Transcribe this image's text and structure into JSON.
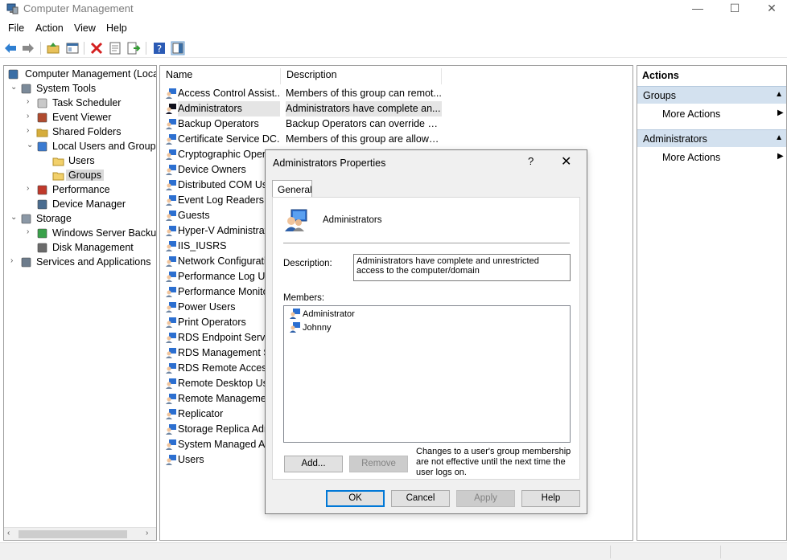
{
  "window": {
    "title": "Computer Management",
    "min_glyph": "—",
    "max_glyph": "☐",
    "close_glyph": "✕"
  },
  "menu": [
    "File",
    "Action",
    "View",
    "Help"
  ],
  "toolbar": [
    "back-arrow-icon",
    "forward-arrow-icon",
    "up-folder-icon",
    "show-hide-tree-icon",
    "delete-icon",
    "properties-icon",
    "export-list-icon",
    "help-icon",
    "show-hide-action-pane-icon"
  ],
  "tree": {
    "items": [
      {
        "label": "Computer Management (Local",
        "icon": "computer-icon",
        "arrow": "",
        "level": 0
      },
      {
        "label": "System Tools",
        "icon": "tools-icon",
        "arrow": "⌄",
        "level": 1
      },
      {
        "label": "Task Scheduler",
        "icon": "clock-icon",
        "arrow": "›",
        "level": 2
      },
      {
        "label": "Event Viewer",
        "icon": "event-viewer-icon",
        "arrow": "›",
        "level": 2
      },
      {
        "label": "Shared Folders",
        "icon": "shared-folder-icon",
        "arrow": "›",
        "level": 2
      },
      {
        "label": "Local Users and Groups",
        "icon": "users-groups-icon",
        "arrow": "⌄",
        "level": 2
      },
      {
        "label": "Users",
        "icon": "folder-icon",
        "arrow": "",
        "level": 3
      },
      {
        "label": "Groups",
        "icon": "folder-icon",
        "arrow": "",
        "level": 3,
        "selected": true
      },
      {
        "label": "Performance",
        "icon": "performance-icon",
        "arrow": "›",
        "level": 2
      },
      {
        "label": "Device Manager",
        "icon": "device-manager-icon",
        "arrow": "",
        "level": 2
      },
      {
        "label": "Storage",
        "icon": "storage-icon",
        "arrow": "⌄",
        "level": 1
      },
      {
        "label": "Windows Server Backup",
        "icon": "backup-icon",
        "arrow": "›",
        "level": 2
      },
      {
        "label": "Disk Management",
        "icon": "disk-icon",
        "arrow": "",
        "level": 2
      },
      {
        "label": "Services and Applications",
        "icon": "services-icon",
        "arrow": "›",
        "level": 1
      }
    ],
    "scroll_left": "‹",
    "scroll_right": "›"
  },
  "list": {
    "col_name": "Name",
    "col_desc": "Description",
    "rows": [
      {
        "name": "Access Control Assist...",
        "desc": "Members of this group can remot..."
      },
      {
        "name": "Administrators",
        "desc": "Administrators have complete an...",
        "selected": true
      },
      {
        "name": "Backup Operators",
        "desc": "Backup Operators can override se..."
      },
      {
        "name": "Certificate Service DC...",
        "desc": "Members of this group are allowe..."
      },
      {
        "name": "Cryptographic Opera",
        "desc": ""
      },
      {
        "name": "Device Owners",
        "desc": ""
      },
      {
        "name": "Distributed COM Use",
        "desc": ""
      },
      {
        "name": "Event Log Readers",
        "desc": ""
      },
      {
        "name": "Guests",
        "desc": ""
      },
      {
        "name": "Hyper-V Administrat",
        "desc": ""
      },
      {
        "name": "IIS_IUSRS",
        "desc": ""
      },
      {
        "name": "Network Configurati",
        "desc": ""
      },
      {
        "name": "Performance Log Us",
        "desc": ""
      },
      {
        "name": "Performance Monito",
        "desc": ""
      },
      {
        "name": "Power Users",
        "desc": ""
      },
      {
        "name": "Print Operators",
        "desc": ""
      },
      {
        "name": "RDS Endpoint Server",
        "desc": ""
      },
      {
        "name": "RDS Management Se",
        "desc": ""
      },
      {
        "name": "RDS Remote Access",
        "desc": ""
      },
      {
        "name": "Remote Desktop Use",
        "desc": ""
      },
      {
        "name": "Remote Managemen",
        "desc": ""
      },
      {
        "name": "Replicator",
        "desc": ""
      },
      {
        "name": "Storage Replica Adm",
        "desc": ""
      },
      {
        "name": "System Managed Ac",
        "desc": ""
      },
      {
        "name": "Users",
        "desc": ""
      }
    ]
  },
  "actions": {
    "header": "Actions",
    "sections": [
      {
        "title": "Groups",
        "item": "More Actions"
      },
      {
        "title": "Administrators",
        "item": "More Actions"
      }
    ],
    "collapse_glyph": "▲",
    "more_glyph": "▶"
  },
  "dialog": {
    "title": "Administrators Properties",
    "help_glyph": "?",
    "close_glyph": "✕",
    "tab": "General",
    "group_name": "Administrators",
    "description_label": "Description:",
    "description_value": "Administrators have complete and unrestricted access to the computer/domain",
    "members_label": "Members:",
    "members": [
      "Administrator",
      "Johnny"
    ],
    "add_btn": "Add...",
    "remove_btn": "Remove",
    "note": "Changes to a user's group membership are not effective until the next time the user logs on.",
    "ok_btn": "OK",
    "cancel_btn": "Cancel",
    "apply_btn": "Apply",
    "help_btn": "Help"
  },
  "colors": {
    "accent": "#0078d7",
    "section_bg": "#d3e1ef",
    "selection": "#e5e5e5"
  }
}
